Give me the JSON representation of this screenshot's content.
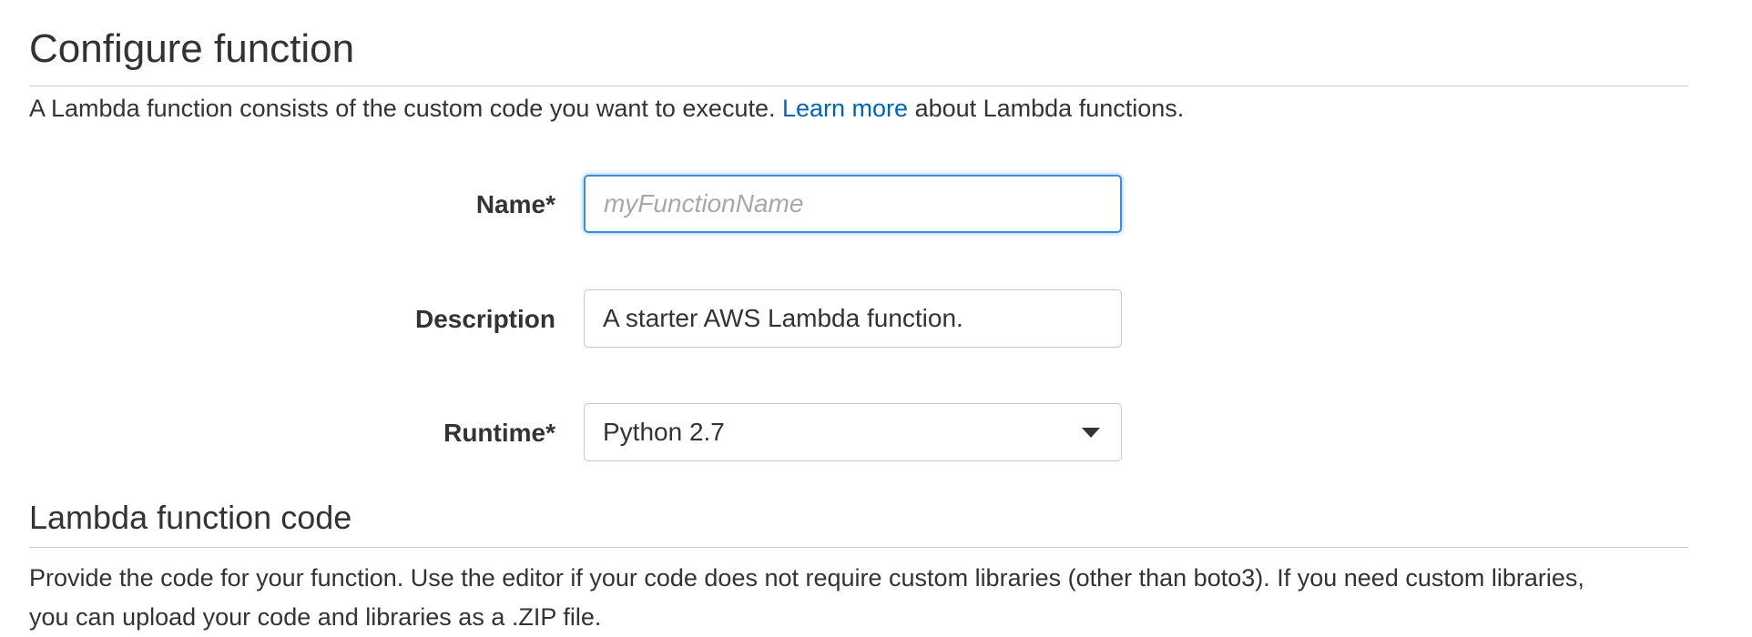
{
  "configure": {
    "title": "Configure function",
    "intro_before": "A Lambda function consists of the custom code you want to execute. ",
    "intro_link": "Learn more",
    "intro_after": " about Lambda functions."
  },
  "form": {
    "name": {
      "label": "Name*",
      "placeholder": "myFunctionName",
      "value": ""
    },
    "description": {
      "label": "Description",
      "value": "A starter AWS Lambda function."
    },
    "runtime": {
      "label": "Runtime*",
      "selected": "Python 2.7"
    }
  },
  "code_section": {
    "title": "Lambda function code",
    "description_line1": "Provide the code for your function. Use the editor if your code does not require custom libraries (other than boto3). If you need custom libraries,",
    "description_line2": "you can upload your code and libraries as a .ZIP file."
  },
  "colors": {
    "link": "#0066b3",
    "focus_border": "#3b8ede",
    "text": "#333333",
    "rule": "#cccccc"
  },
  "icons": {
    "runtime_dropdown": "caret-down-icon"
  }
}
